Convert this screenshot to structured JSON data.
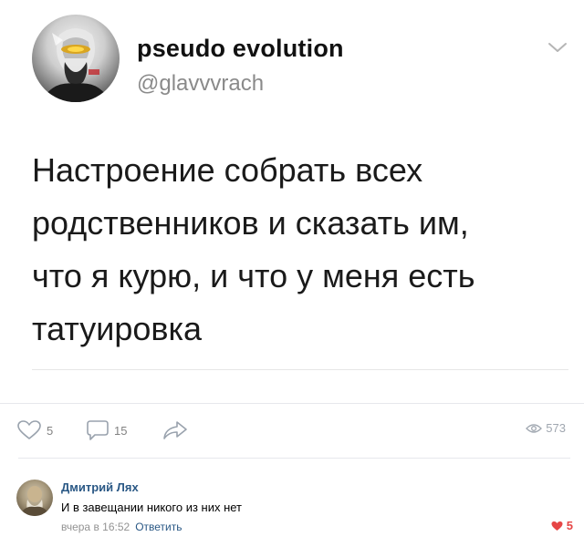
{
  "tweet": {
    "display_name": "pseudo evolution",
    "handle": "@glavvvrach",
    "text_lines": [
      "Настроение собрать всех",
      "родственников и сказать им,",
      "что я курю, и что у меня есть",
      "татуировка"
    ],
    "menu_icon": "chevron-down-icon"
  },
  "actions": {
    "likes": "5",
    "comments": "15",
    "views": "573",
    "like_icon": "heart-outline-icon",
    "comment_icon": "comment-icon",
    "share_icon": "share-arrow-icon",
    "views_icon": "eye-icon"
  },
  "comment": {
    "author": "Дмитрий Лях",
    "text": "И в завещании никого из них нет",
    "time": "вчера в 16:52",
    "reply_label": "Ответить",
    "likes": "5",
    "likes_icon": "heart-filled-icon",
    "like_color": "#e64646"
  },
  "colors": {
    "link": "#2a5885",
    "muted": "#828282"
  }
}
